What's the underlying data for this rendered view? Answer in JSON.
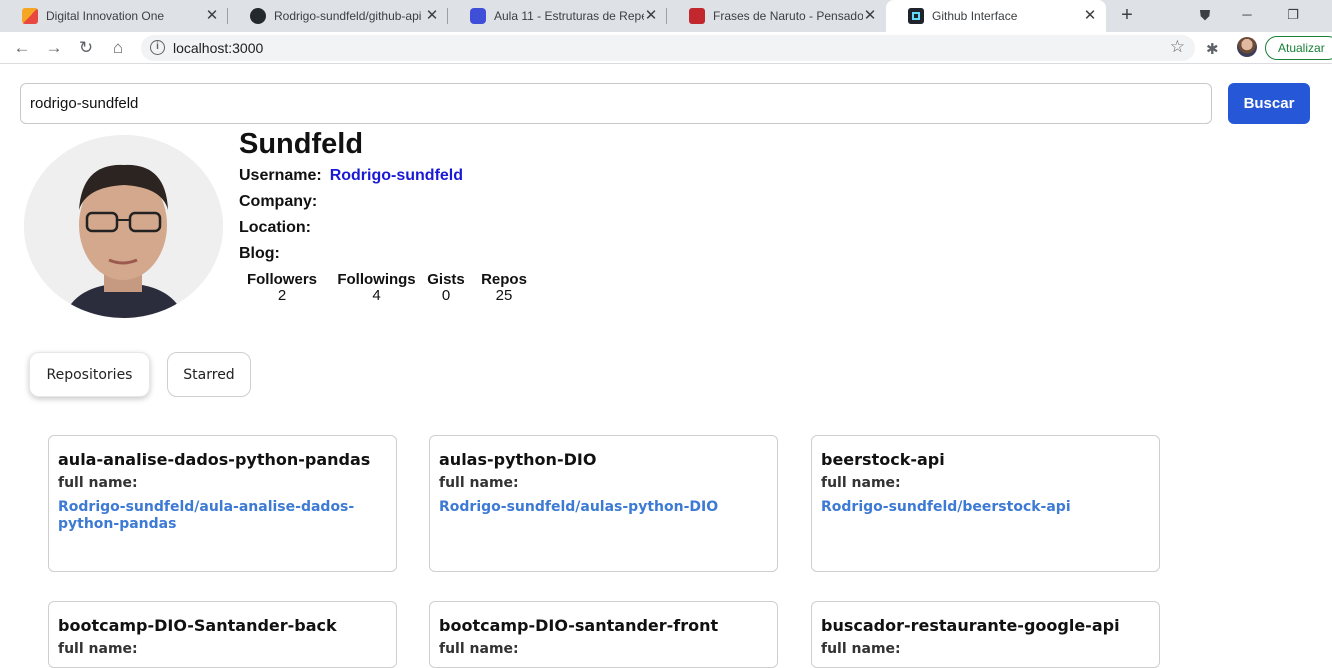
{
  "browser": {
    "tabs": [
      {
        "title": "Digital Innovation One",
        "favicon": "dio-icon",
        "active": false
      },
      {
        "title": "Rodrigo-sundfeld/github-api",
        "favicon": "github-icon",
        "active": false
      },
      {
        "title": "Aula 11 - Estruturas de Repeti",
        "favicon": "play-icon",
        "active": false
      },
      {
        "title": "Frases de Naruto - Pensador",
        "favicon": "quote-icon",
        "active": false
      },
      {
        "title": "Github Interface",
        "favicon": "react-icon",
        "active": true
      }
    ],
    "url": "localhost:3000",
    "update_label": "Atualizar"
  },
  "search": {
    "value": "rodrigo-sundfeld",
    "button_label": "Buscar"
  },
  "profile": {
    "name": "Sundfeld",
    "username_label": "Username:",
    "username": "Rodrigo-sundfeld",
    "company_label": "Company:",
    "location_label": "Location:",
    "blog_label": "Blog:",
    "stats": [
      {
        "label": "Followers",
        "value": "2"
      },
      {
        "label": "Followings",
        "value": "4"
      },
      {
        "label": "Gists",
        "value": "0"
      },
      {
        "label": "Repos",
        "value": "25"
      }
    ]
  },
  "tabs": [
    {
      "label": "Repositories",
      "active": true
    },
    {
      "label": "Starred",
      "active": false
    }
  ],
  "repos": [
    {
      "name": "aula-analise-dados-python-pandas",
      "full_name_label": "full name:",
      "full_name": "Rodrigo-sundfeld/aula-analise-dados-python-pandas"
    },
    {
      "name": "aulas-python-DIO",
      "full_name_label": "full name:",
      "full_name": "Rodrigo-sundfeld/aulas-python-DIO"
    },
    {
      "name": "beerstock-api",
      "full_name_label": "full name:",
      "full_name": "Rodrigo-sundfeld/beerstock-api"
    },
    {
      "name": "bootcamp-DIO-Santander-back",
      "full_name_label": "full name:",
      "full_name": ""
    },
    {
      "name": "bootcamp-DIO-santander-front",
      "full_name_label": "full name:",
      "full_name": ""
    },
    {
      "name": "buscador-restaurante-google-api",
      "full_name_label": "full name:",
      "full_name": ""
    }
  ],
  "colors": {
    "accent": "#2557d6",
    "link": "#3d7ad4",
    "username_link": "#1a1ad6"
  }
}
